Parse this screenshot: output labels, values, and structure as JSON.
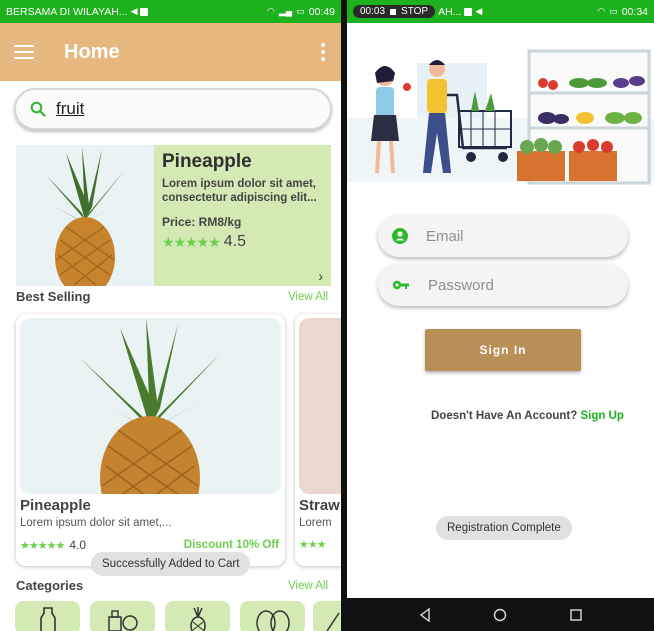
{
  "left": {
    "status": {
      "carrier": "BERSAMA DI WILAYAH...",
      "time": "00:49"
    },
    "appbar": {
      "title": "Home"
    },
    "search": {
      "value": "fruit"
    },
    "featured": {
      "name": "Pineapple",
      "description": "Lorem ipsum dolor sit amet, consectetur adipiscing elit...",
      "price": "Price: RM8/kg",
      "rating": "4.5"
    },
    "best_selling": {
      "title": "Best Selling",
      "view_all": "View All",
      "products": [
        {
          "name": "Pineapple",
          "description": "Lorem ipsum dolor sit amet,...",
          "rating": "4.0",
          "discount": "Discount 10% Off"
        },
        {
          "name": "Straw",
          "description": "Lorem"
        }
      ]
    },
    "toast": "Successfully Added to Cart",
    "categories": {
      "title": "Categories",
      "view_all": "View All"
    }
  },
  "right": {
    "status": {
      "recording": "00:03",
      "stop": "STOP",
      "carrier": "AH...",
      "time": "00:34"
    },
    "email_placeholder": "Email",
    "password_placeholder": "Password",
    "signin_label": "Sign In",
    "no_account": "Doesn't Have An Account?",
    "signup_label": "Sign Up",
    "toast": "Registration Complete"
  },
  "colors": {
    "status_green": "#1eb11e",
    "appbar_tan": "#e6b77f",
    "card_green": "#d4eab5",
    "accent_green": "#6ccf4c",
    "button_brown": "#b88f57"
  },
  "icons": [
    "menu-icon",
    "more-vert-icon",
    "search-icon",
    "star-icon",
    "chevron-right-icon",
    "user-icon",
    "key-icon",
    "back-icon",
    "home-icon",
    "recents-icon"
  ]
}
